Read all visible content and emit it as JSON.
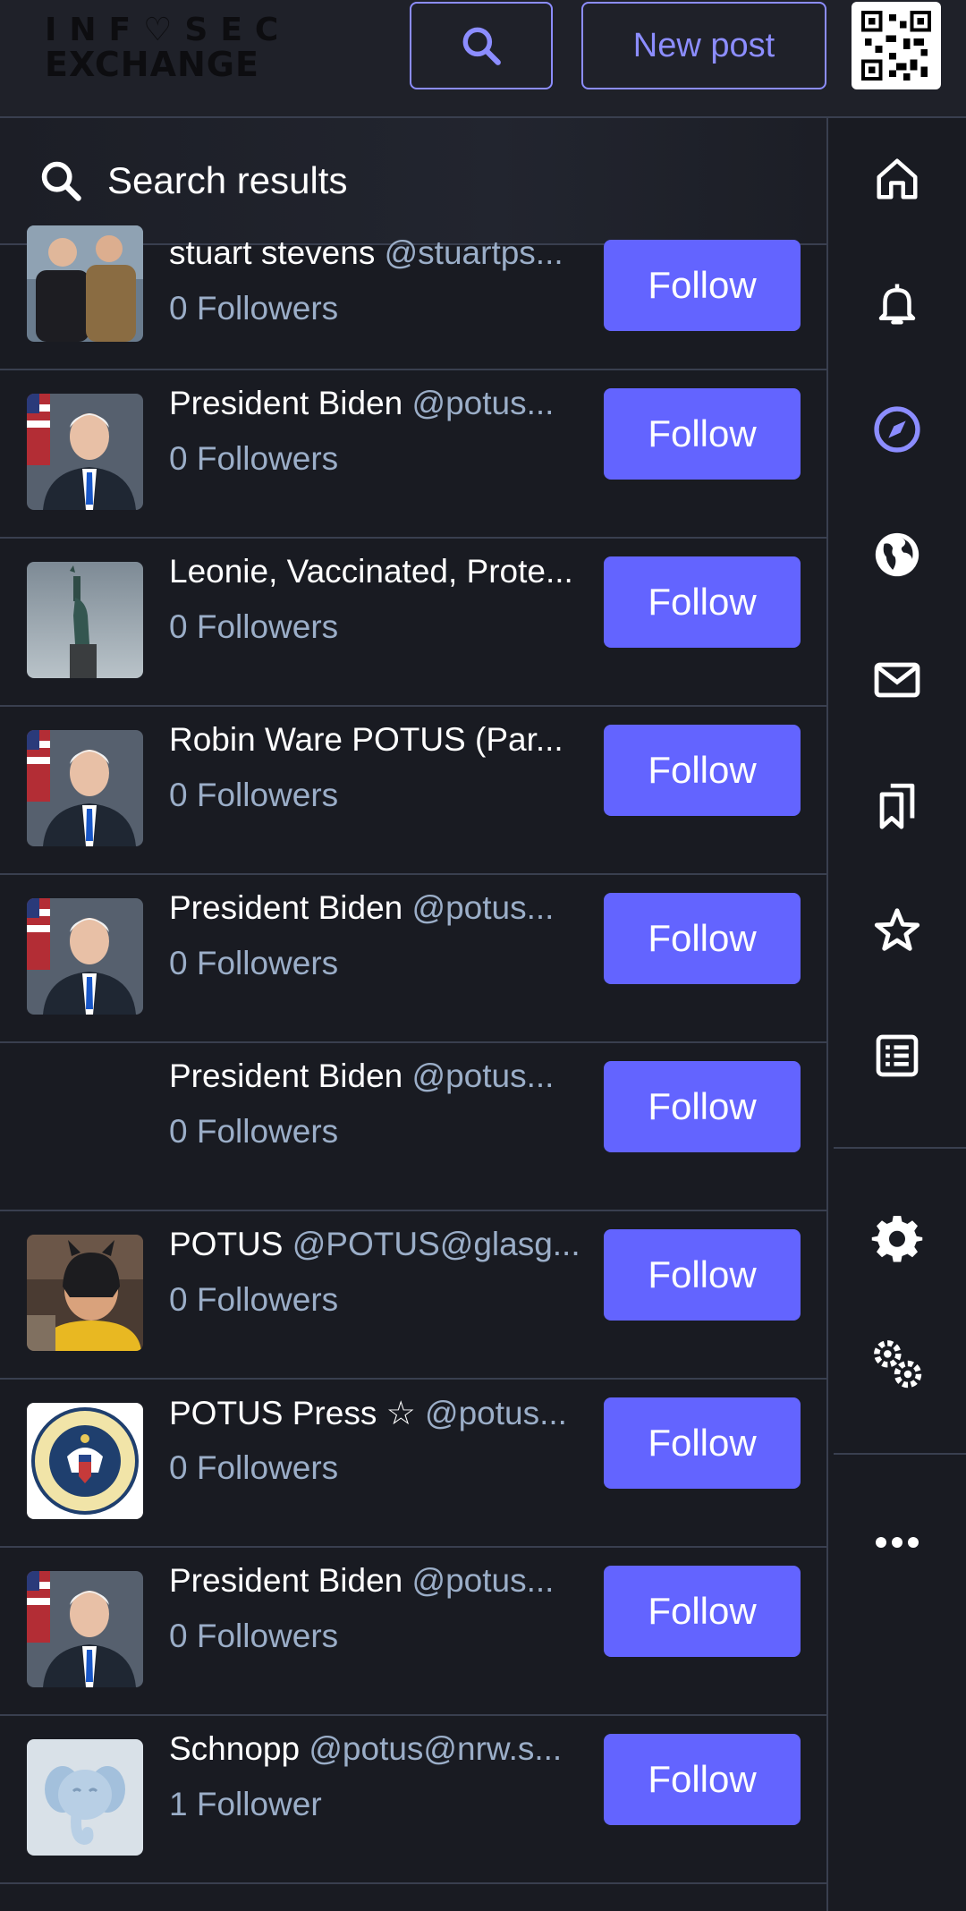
{
  "header": {
    "logo_top": "INF♡SEC",
    "logo_bottom": "EXCHANGE",
    "new_post_label": "New post",
    "qr_icon": "qr-code-icon"
  },
  "search": {
    "title": "Search results"
  },
  "results": [
    {
      "name": "stuart stevens",
      "handle": "@stuartps...",
      "followers": "0 Followers",
      "button": "Follow",
      "avatar": "photo-two-men"
    },
    {
      "name": "President Biden",
      "handle": "@potus...",
      "followers": "0 Followers",
      "button": "Follow",
      "avatar": "photo-biden"
    },
    {
      "name": "Leonie, Vaccinated, Prote...",
      "handle": "",
      "followers": "0 Followers",
      "button": "Follow",
      "avatar": "photo-statue-of-liberty"
    },
    {
      "name": "Robin Ware POTUS (Par...",
      "handle": "",
      "followers": "0 Followers",
      "button": "Follow",
      "avatar": "photo-biden"
    },
    {
      "name": "President Biden",
      "handle": "@potus...",
      "followers": "0 Followers",
      "button": "Follow",
      "avatar": "photo-biden"
    },
    {
      "name": "President Biden",
      "handle": "@potus...",
      "followers": "0 Followers",
      "button": "Follow",
      "avatar": "none"
    },
    {
      "name": "POTUS",
      "handle": "@POTUS@glasg...",
      "followers": "0 Followers",
      "button": "Follow",
      "avatar": "photo-batman-mask"
    },
    {
      "name": "POTUS Press ☆",
      "handle": "@potus...",
      "followers": "0 Followers",
      "button": "Follow",
      "avatar": "presidential-seal"
    },
    {
      "name": "President Biden",
      "handle": "@potus...",
      "followers": "0 Followers",
      "button": "Follow",
      "avatar": "photo-biden"
    },
    {
      "name": "Schnopp",
      "handle": "@potus@nrw.s...",
      "followers": "1 Follower",
      "button": "Follow",
      "avatar": "default-mastodon-elephant"
    }
  ],
  "nav": [
    {
      "icon": "home-icon"
    },
    {
      "icon": "bell-icon"
    },
    {
      "icon": "compass-icon",
      "active": true
    },
    {
      "icon": "globe-icon"
    },
    {
      "icon": "mail-icon"
    },
    {
      "icon": "bookmarks-icon"
    },
    {
      "icon": "star-icon"
    },
    {
      "icon": "list-icon"
    },
    {
      "icon": "gear-icon"
    },
    {
      "icon": "gears-icon"
    },
    {
      "icon": "more-icon"
    }
  ],
  "colors": {
    "background": "#191b22",
    "accent": "#6364ff",
    "accent_light": "#8c8dff",
    "secondary_text": "#9baec8",
    "border": "#393f4f"
  }
}
